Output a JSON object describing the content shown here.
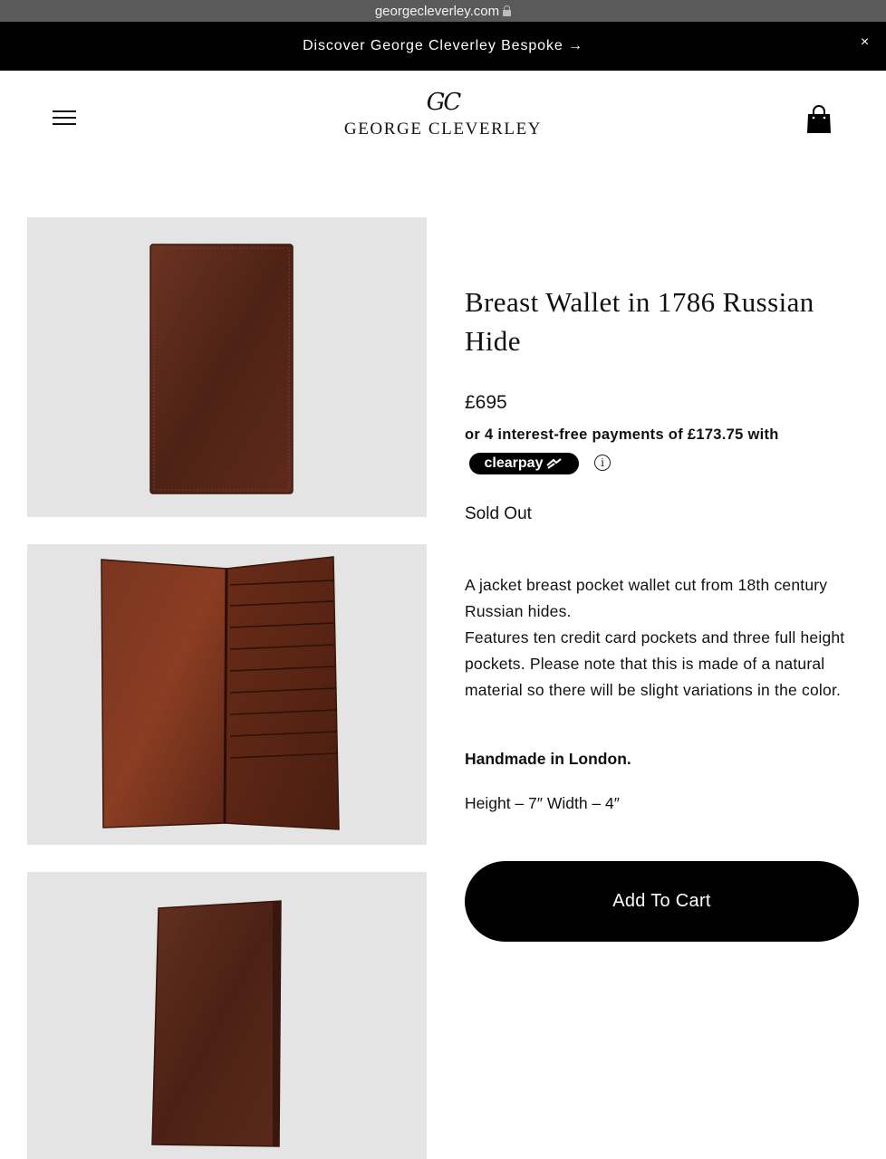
{
  "browser": {
    "url": "georgecleverley.com"
  },
  "announcement": {
    "text": "Discover George Cleverley Bespoke →",
    "close_glyph": "×"
  },
  "header": {
    "menu_icon": "hamburger-menu-icon",
    "logo_monogram": "GC",
    "logo_wordmark": "GEORGE CLEVERLEY",
    "cart_icon": "shopping-bag-icon"
  },
  "gallery": {
    "images": [
      {
        "name": "wallet-closed-front",
        "leather_color": "#5a2a1a"
      },
      {
        "name": "wallet-open-interior",
        "leather_color": "#6a2c18"
      },
      {
        "name": "wallet-closed-angled",
        "leather_color": "#5b2a1b"
      }
    ],
    "background_color": "#e4e4e4"
  },
  "product": {
    "title": "Breast Wallet in 1786 Russian Hide",
    "price": "£695",
    "installments_text": "or 4 interest-free payments of £173.75 with",
    "clearpay_label": "clearpay",
    "info_glyph": "i",
    "status": "Sold Out",
    "description": [
      "A jacket breast pocket wallet cut from 18th century Russian hides.",
      "Features ten credit card pockets and three full height pockets. Please note that this is made of a natural material so there will be slight variations in the color."
    ],
    "made_in": "Handmade in London.",
    "dimensions": "Height – 7″ Width – 4″",
    "add_to_cart_label": "Add To Cart"
  },
  "colors": {
    "accent": "#000000",
    "announcement_bg": "#000000",
    "urlbar_bg": "#5a5a5a"
  }
}
